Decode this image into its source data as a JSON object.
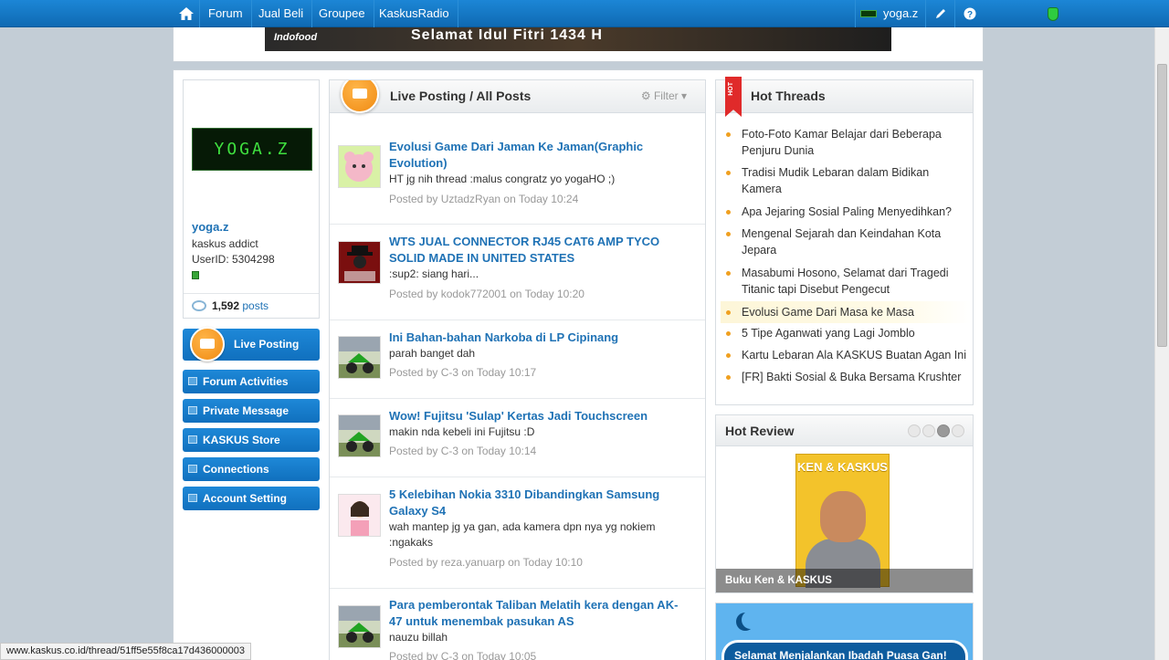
{
  "topnav": {
    "links": [
      "Forum",
      "Jual Beli",
      "Groupee",
      "KaskusRadio"
    ],
    "username": "yoga.z"
  },
  "banner": {
    "brand": "Indofood",
    "message": "Selamat Idul Fitri 1434 H"
  },
  "profile": {
    "avatar_text": "YOGA.Z",
    "name": "yoga.z",
    "rank": "kaskus addict",
    "userid": "UserID: 5304298",
    "posts_count": "1,592",
    "posts_label": "posts"
  },
  "sidebar": {
    "items": [
      "Live Posting",
      "Forum Activities",
      "Private Message",
      "KASKUS Store",
      "Connections",
      "Account Setting"
    ]
  },
  "live": {
    "title": "Live Posting / All Posts",
    "filter": "⚙ Filter ▾",
    "posts": [
      {
        "title": "Evolusi Game Dari Jaman Ke Jaman(Graphic Evolution)",
        "snippet": "HT jg nih thread :malus congratz yo yogaHO ;)",
        "meta": "Posted by UztadzRyan on Today 10:24"
      },
      {
        "title": "WTS JUAL CONNECTOR RJ45 CAT6 AMP TYCO SOLID MADE IN UNITED STATES",
        "snippet": ":sup2: siang hari...",
        "meta": "Posted by kodok772001 on Today 10:20"
      },
      {
        "title": "Ini Bahan-bahan Narkoba di LP Cipinang",
        "snippet": "parah banget dah",
        "meta": "Posted by C-3 on Today 10:17"
      },
      {
        "title": "Wow! Fujitsu 'Sulap' Kertas Jadi Touchscreen",
        "snippet": "makin nda kebeli ini Fujitsu :D",
        "meta": "Posted by C-3 on Today 10:14"
      },
      {
        "title": "5 Kelebihan Nokia 3310 Dibandingkan Samsung Galaxy S4",
        "snippet": "wah mantep jg ya gan, ada kamera dpn nya yg nokiem :ngakaks",
        "meta": "Posted by reza.yanuarp on Today 10:10"
      },
      {
        "title": "Para pemberontak Taliban Melatih kera dengan AK-47 untuk menembak pasukan AS",
        "snippet": "nauzu billah",
        "meta": "Posted by C-3 on Today 10:05"
      }
    ]
  },
  "hot": {
    "ribbon": "HOT",
    "title": "Hot Threads",
    "items": [
      "Foto-Foto Kamar Belajar dari Beberapa Penjuru Dunia",
      "Tradisi Mudik Lebaran dalam Bidikan Kamera",
      "Apa Jejaring Sosial Paling Menyedihkan?",
      "Mengenal Sejarah dan Keindahan Kota Jepara",
      "Masabumi Hosono, Selamat dari Tragedi Titanic tapi Disebut Pengecut",
      "Evolusi Game Dari Masa ke Masa",
      "5 Tipe Aganwati yang Lagi Jomblo",
      "Kartu Lebaran Ala KASKUS Buatan Agan Ini",
      "[FR] Bakti Sosial & Buka Bersama Krushter"
    ]
  },
  "review": {
    "title": "Hot Review",
    "book_title": "KEN & KASKUS",
    "caption": "Buku Ken & KASKUS",
    "active_slide": 3
  },
  "ramadan": {
    "text": "Selamat Menjalankan Ibadah Puasa Gan!"
  },
  "status_url": "www.kaskus.co.id/thread/51ff5e55f8ca17d436000003",
  "colors": {
    "nav": "#1578c6",
    "link": "#1f72b5",
    "accent_orange": "#f08a12",
    "hot_red": "#e02a2a"
  }
}
